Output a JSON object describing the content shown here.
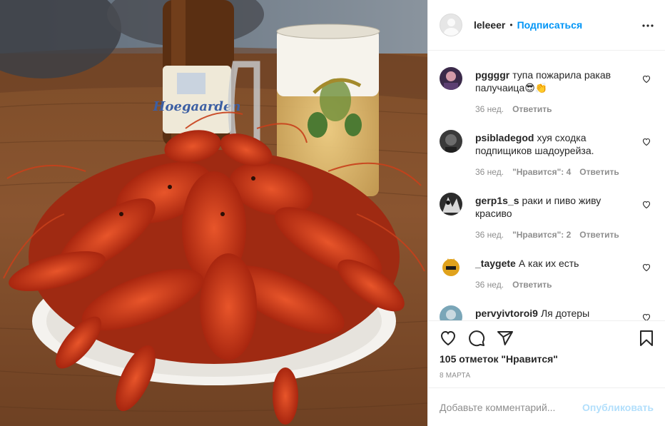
{
  "photo": {
    "bottle_label": "Hoegaarden"
  },
  "post": {
    "author": "leleeer",
    "separator": "•",
    "follow_label": "Подписаться",
    "likes_text": "105 отметок \"Нравится\"",
    "date": "8 марта"
  },
  "comments": [
    {
      "user": "pggggr",
      "text": "тупа пожарила ракав палучаица😎👏",
      "time": "36 нед.",
      "likes": "",
      "reply": "Ответить",
      "avatar_color": "#3b2a4a"
    },
    {
      "user": "psibladegod",
      "text": "хуя сходка подпищиков шадоурейза.",
      "time": "36 нед.",
      "likes": "\"Нравится\": 4",
      "reply": "Ответить",
      "avatar_color": "#3a3a3a"
    },
    {
      "user": "gerp1s_s",
      "text": "раки и пиво живу красиво",
      "time": "36 нед.",
      "likes": "\"Нравится\": 2",
      "reply": "Ответить",
      "avatar_color": "#2c2c2c"
    },
    {
      "user": "_taygete",
      "text": "А как их есть",
      "time": "36 нед.",
      "likes": "",
      "reply": "Ответить",
      "avatar_color": "#e0a21c"
    },
    {
      "user": "pervyivtoroi9",
      "text": "Ля дотеры",
      "time": "",
      "likes": "",
      "reply": "",
      "avatar_color": "#7aa6b8"
    }
  ],
  "add_comment": {
    "placeholder": "Добавьте комментарий...",
    "post_label": "Опубликовать"
  },
  "icons": {
    "more": "more-dots-icon",
    "like": "heart-icon",
    "comment": "comment-bubble-icon",
    "share": "paper-plane-icon",
    "save": "bookmark-icon"
  },
  "colors": {
    "link": "#0095f6",
    "muted": "#8e8e8e",
    "post_disabled": "#b2dffc"
  }
}
